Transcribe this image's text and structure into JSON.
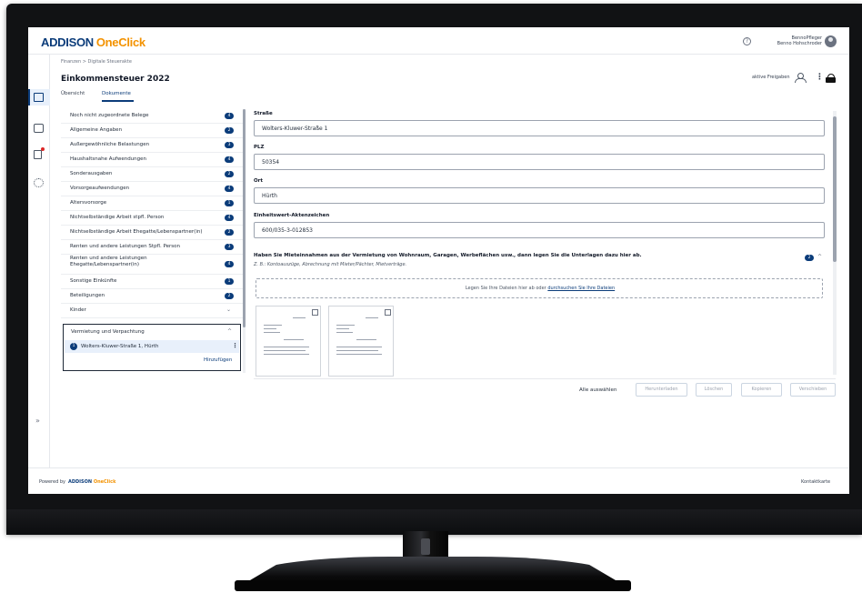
{
  "app": {
    "brand": "ADDISON",
    "brand_accent": "OneClick",
    "colors": {
      "primary": "#0b3c7a",
      "accent": "#f39200"
    }
  },
  "header": {
    "help_icon": "?",
    "user_line1": "BennoPfleger",
    "user_line2": "Benno Hohschroder"
  },
  "page": {
    "breadcrumb": "Finanzen  >  Digitale Steuerakte",
    "title": "Einkommensteuer 2022",
    "tabs": [
      "Übersicht",
      "Dokumente"
    ],
    "freigaben_label": "aktive Freigaben"
  },
  "categories": [
    {
      "label": "Noch nicht zugeordnete Belege",
      "badge": "4"
    },
    {
      "label": "Allgemeine Angaben",
      "badge": "2"
    },
    {
      "label": "Außergewöhnliche Belastungen",
      "badge": "3"
    },
    {
      "label": "Haushaltsnahe Aufwendungen",
      "badge": "4"
    },
    {
      "label": "Sonderausgaben",
      "badge": "2"
    },
    {
      "label": "Vorsorgeaufwendungen",
      "badge": "4"
    },
    {
      "label": "Altersvorsorge",
      "badge": "1"
    },
    {
      "label": "Nichtselbständige Arbeit stpfl. Person",
      "badge": "4"
    },
    {
      "label": "Nichtselbständige Arbeit Ehegatte/Lebenspartner(in)",
      "badge": "2"
    },
    {
      "label": "Renten und andere Leistungen Stpfl. Person",
      "badge": "3"
    },
    {
      "label": "Renten und andere Leistungen Ehegatte/Lebenspartner(in)",
      "badge": "4"
    },
    {
      "label": "Sonstige Einkünfte",
      "badge": "1"
    },
    {
      "label": "Beteiligungen",
      "badge": "2"
    },
    {
      "label": "Kinder",
      "badge": ""
    }
  ],
  "vermietung": {
    "title": "Vermietung und Verpachtung",
    "item_num": "1",
    "item_address": "Wolters-Kluwer-Straße 1, Hürth",
    "add_label": "Hinzufügen"
  },
  "form": {
    "street_label": "Straße",
    "street_value": "Wolters-Kluwer-Straße 1",
    "plz_label": "PLZ",
    "plz_value": "50354",
    "ort_label": "Ort",
    "ort_value": "Hürth",
    "ez_label": "Einheitswert-Aktenzeichen",
    "ez_value": "600/035-3-012853"
  },
  "upload": {
    "question": "Haben Sie Mieteinnahmen aus der Vermietung von Wohnraum, Garagen, Werbeflächen usw., dann legen Sie die Unterlagen dazu hier ab.",
    "hint": "Z. B.: Kontoauszüge, Abrechnung mit Mieter/Pächter, Mietverträge.",
    "badge": "2",
    "drop_text": "Legen Sie Ihre Dateien hier ab oder",
    "drop_link": "durchsuchen Sie Ihre Dateien"
  },
  "actions": {
    "select_all": "Alle auswählen",
    "download": "Herunterladen",
    "delete": "Löschen",
    "copy": "Kopieren",
    "move": "Verschieben"
  },
  "footer": {
    "powered_by": "Powered by",
    "logo_a": "ADDISON",
    "logo_b": "OneClick",
    "contact": "Kontaktkarte"
  }
}
